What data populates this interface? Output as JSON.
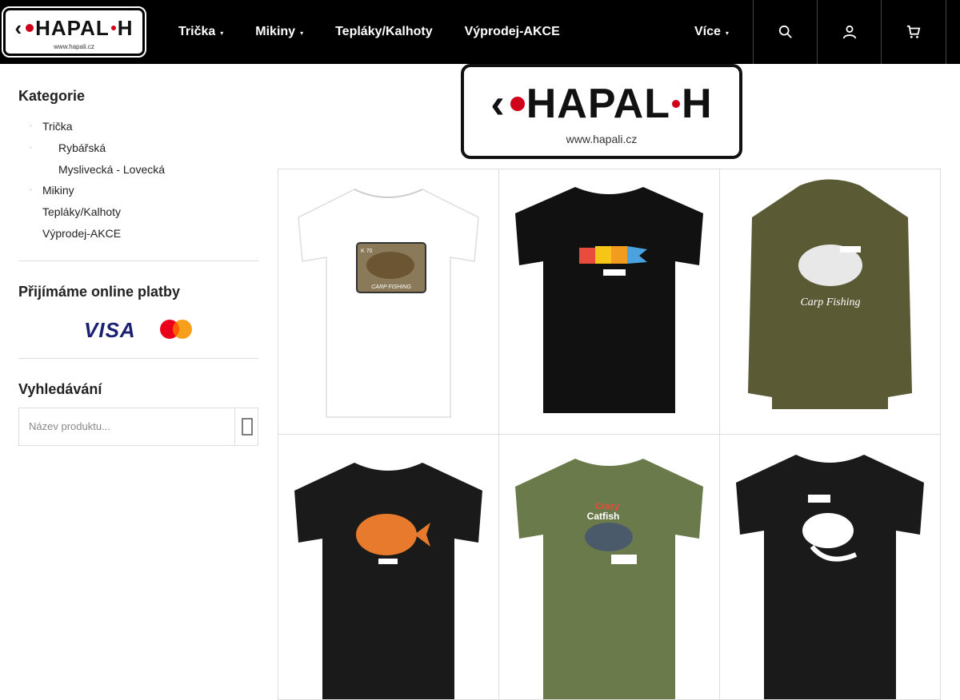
{
  "header": {
    "logo_text_left": "HAPAL",
    "logo_text_right": "H",
    "logo_url": "www.hapali.cz",
    "nav": [
      {
        "label": "Trička",
        "has_submenu": true
      },
      {
        "label": "Mikiny",
        "has_submenu": true
      },
      {
        "label": "Tepláky/Kalhoty",
        "has_submenu": false
      },
      {
        "label": "Výprodej-AKCE",
        "has_submenu": false
      }
    ],
    "more_label": "Více",
    "buttons": [
      "search-icon",
      "user-icon",
      "cart-icon"
    ]
  },
  "sidebar": {
    "categories_title": "Kategorie",
    "categories": [
      {
        "label": "Trička",
        "level": 1
      },
      {
        "label": "Rybářská",
        "level": 2
      },
      {
        "label": "Myslivecká - Lovecká",
        "level": 2
      },
      {
        "label": "Mikiny",
        "level": 1
      },
      {
        "label": "Tepláky/Kalhoty",
        "level": 1
      },
      {
        "label": "Výprodej-AKCE",
        "level": 1
      }
    ],
    "payments_title": "Přijímáme online platby",
    "payment_visa": "VISA",
    "search_title": "Vyhledávání",
    "search_placeholder": "Název produktu..."
  },
  "banner": {
    "logo_text": "HAPAL",
    "logo_url": "www.hapali.cz"
  },
  "products": [
    {
      "garment": "t-shirt",
      "color": "#ffffff",
      "print": "Carp Fishing"
    },
    {
      "garment": "t-shirt",
      "color": "#111111",
      "print": "fish lure"
    },
    {
      "garment": "hoodie",
      "color": "#5a5a35",
      "print": "Carp Fishing"
    },
    {
      "garment": "t-shirt",
      "color": "#1a1a1a",
      "print": "carp orange"
    },
    {
      "garment": "t-shirt",
      "color": "#6b7a4a",
      "print": "Crazy Catfish"
    },
    {
      "garment": "t-shirt",
      "color": "#1a1a1a",
      "print": "carp white"
    }
  ],
  "product_texts": {
    "p1_print_label": "CARP FISHING",
    "p1_print_code": "K 70",
    "p3_print_text": "Carp Fishing",
    "p5_print_line1": "Crazy",
    "p5_print_line2": "Catfish"
  },
  "colors": {
    "header_bg": "#000000",
    "accent_red": "#d0021b",
    "visa_blue": "#1a1f71",
    "mc_red": "#eb001b",
    "mc_yellow": "#f79e1b"
  }
}
